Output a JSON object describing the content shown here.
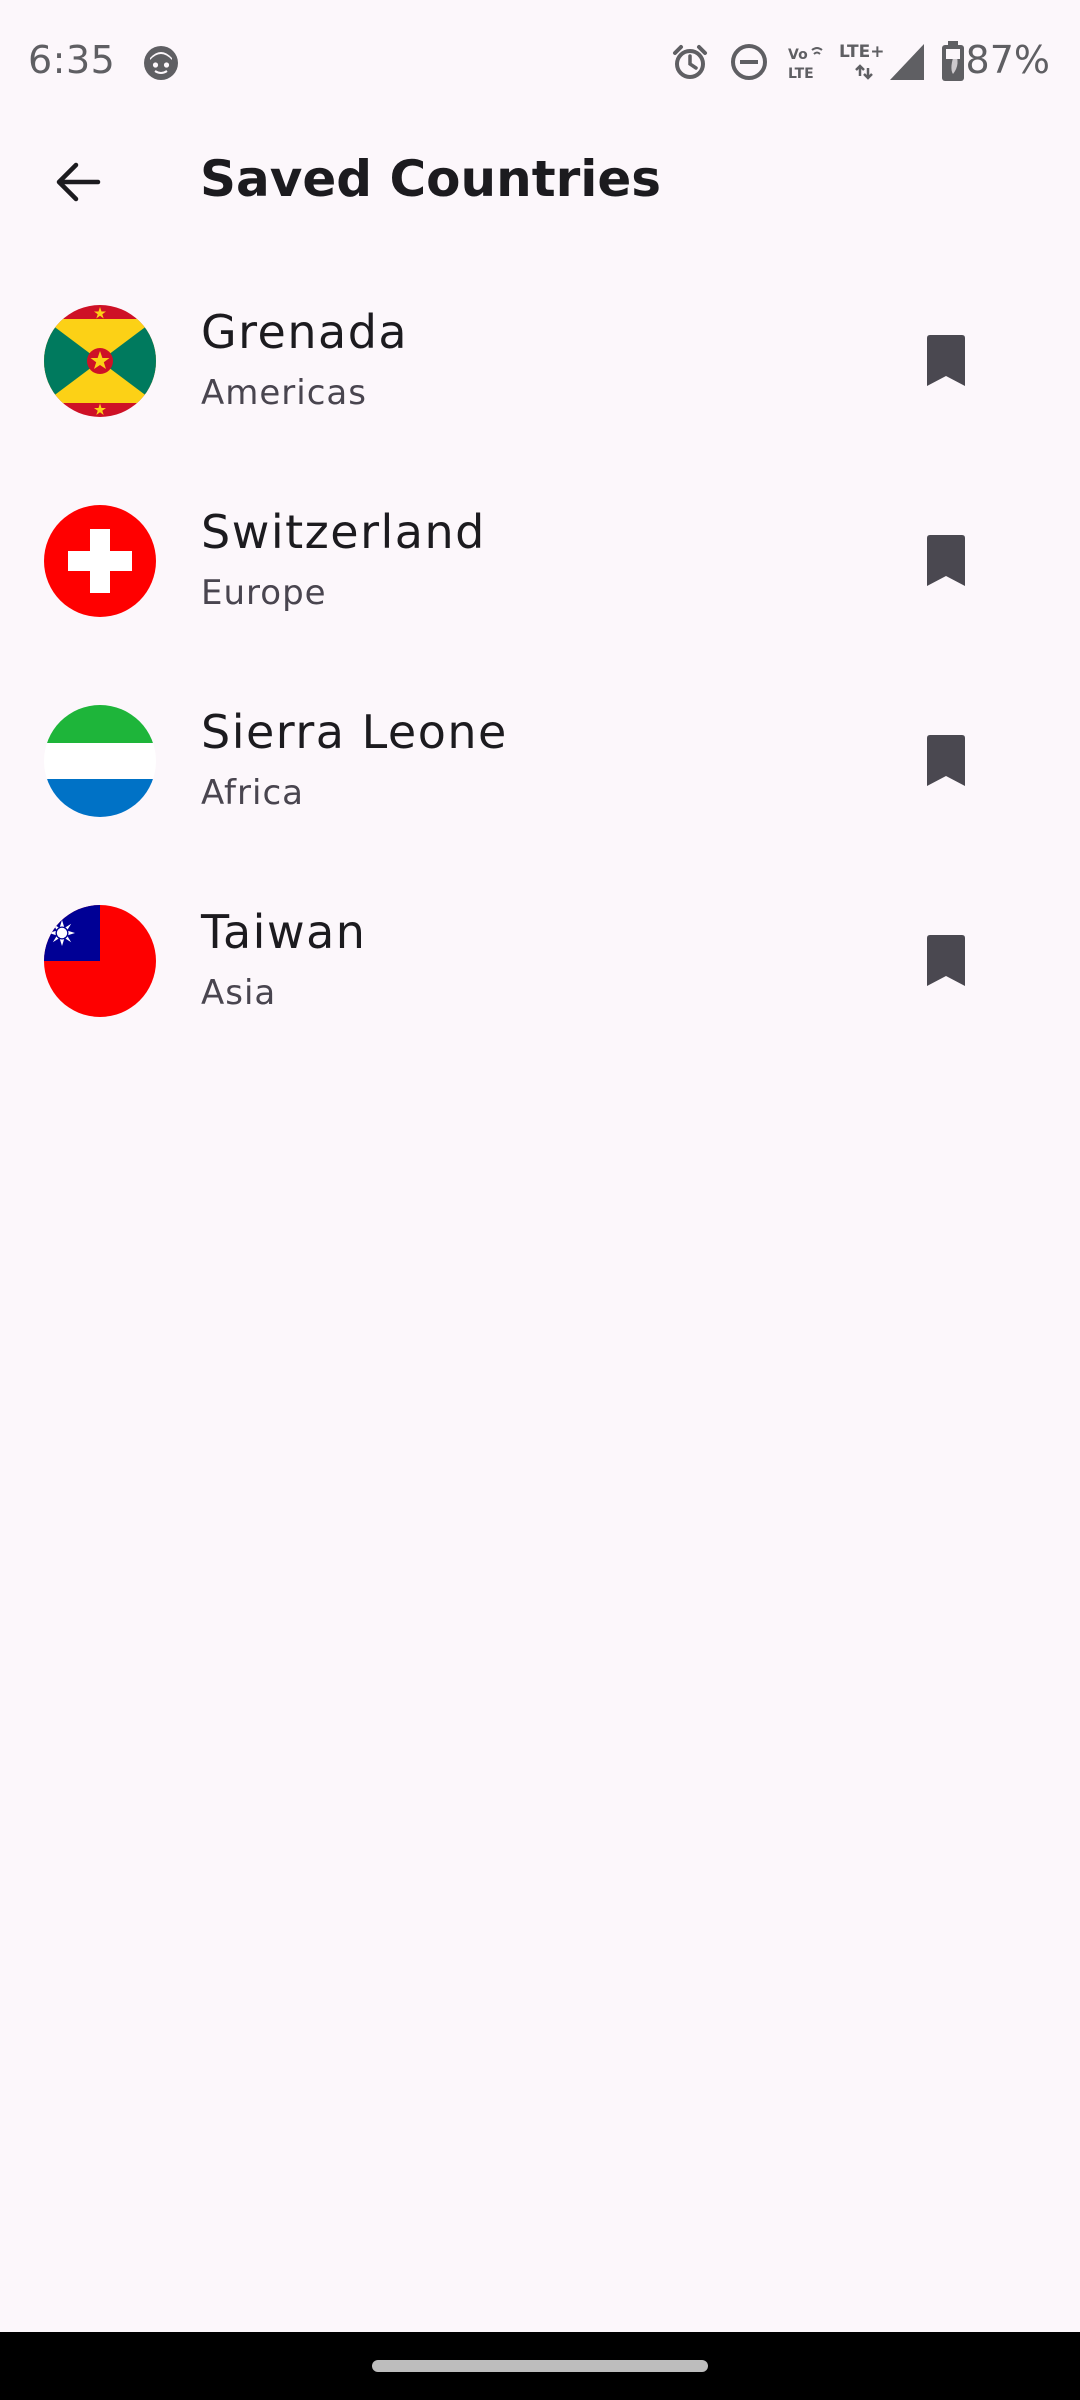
{
  "status_bar": {
    "time": "6:35",
    "battery": "87%",
    "icons": [
      "face-notification-icon",
      "alarm-icon",
      "do-not-disturb-icon",
      "volte-icon",
      "lte-plus-icon",
      "signal-icon",
      "battery-icon"
    ],
    "volte_label_top": "Vo",
    "volte_label_bottom": "LTE",
    "lte_label": "LTE+"
  },
  "app_bar": {
    "back_icon": "arrow-back-icon",
    "title": "Saved Countries"
  },
  "countries": [
    {
      "name": "Grenada",
      "region": "Americas",
      "flag": "grenada-flag",
      "bookmark_icon": "bookmark-filled-icon",
      "saved": true
    },
    {
      "name": "Switzerland",
      "region": "Europe",
      "flag": "switzerland-flag",
      "bookmark_icon": "bookmark-filled-icon",
      "saved": true
    },
    {
      "name": "Sierra Leone",
      "region": "Africa",
      "flag": "sierra-leone-flag",
      "bookmark_icon": "bookmark-filled-icon",
      "saved": true
    },
    {
      "name": "Taiwan",
      "region": "Asia",
      "flag": "taiwan-flag",
      "bookmark_icon": "bookmark-filled-icon",
      "saved": true
    }
  ],
  "colors": {
    "background": "#fcf7fb",
    "title_text": "#1c1b1f",
    "secondary_text": "#49454f",
    "bookmark": "#4a4850",
    "nav_bar": "#000000"
  }
}
